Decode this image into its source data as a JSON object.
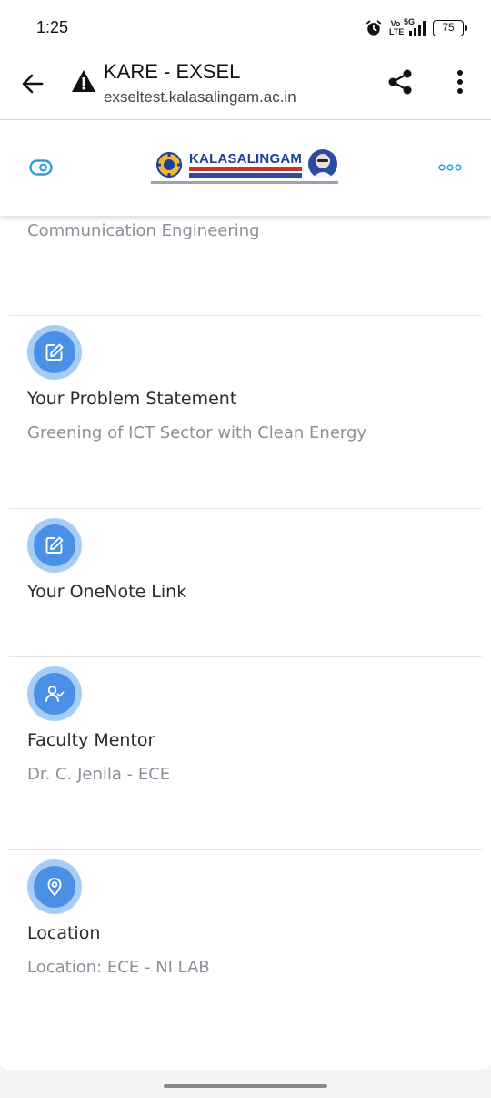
{
  "status_bar": {
    "time": "1:25",
    "volte": "Vo LTE",
    "network": "5G",
    "battery": "75"
  },
  "browser": {
    "title": "KARE - EXSEL",
    "url": "exseltest.kalasalingam.ac.in"
  },
  "app_header": {
    "logo_text": "KALASALINGAM"
  },
  "sections": [
    {
      "label": "",
      "value": "Communication Engineering"
    },
    {
      "label": "Your Problem Statement",
      "value": "Greening of ICT Sector with Clean Energy",
      "icon": "edit-icon"
    },
    {
      "label": "Your OneNote Link",
      "value": "",
      "icon": "edit-icon"
    },
    {
      "label": "Faculty Mentor",
      "value": "Dr. C. Jenila - ECE",
      "icon": "user-check-icon"
    },
    {
      "label": "Location",
      "value": "Location: ECE - NI LAB",
      "icon": "location-pin-icon"
    }
  ],
  "colors": {
    "accent": "#4a90e6",
    "accent_light": "#a6cdf5",
    "text_muted": "#8a8f99"
  }
}
